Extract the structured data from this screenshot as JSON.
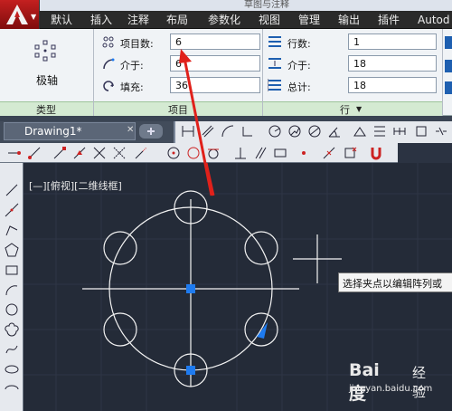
{
  "window": {
    "title": "草图与注释"
  },
  "ribbon_tabs": [
    "默认",
    "插入",
    "注释",
    "布局",
    "参数化",
    "视图",
    "管理",
    "输出",
    "插件",
    "Autod"
  ],
  "ribbon": {
    "type_group": {
      "button_label": "极轴",
      "group_label": "类型"
    },
    "items_group": {
      "group_label": "项目",
      "fields": [
        {
          "label": "项目数:",
          "value": "6",
          "icon": "polar-items-icon"
        },
        {
          "label": "介于:",
          "value": "6",
          "icon": "angle-between-icon"
        },
        {
          "label": "填充:",
          "value": "36",
          "icon": "fill-angle-icon"
        }
      ]
    },
    "rows_group": {
      "group_label": "行",
      "fields": [
        {
          "label": "行数:",
          "value": "1",
          "icon": "rows-icon"
        },
        {
          "label": "介于:",
          "value": "18",
          "icon": "row-between-icon"
        },
        {
          "label": "总计:",
          "value": "18",
          "icon": "row-total-icon"
        }
      ]
    }
  },
  "document_tab": {
    "label": "Drawing1*"
  },
  "canvas": {
    "viewport_label": "[—][俯视][二维线框]",
    "tooltip": "选择夹点以编辑阵列或",
    "grip_color": "#1e7bf0",
    "arrow_color": "#e0211b"
  },
  "watermark": {
    "brand": "Bai度",
    "suffix": "经验",
    "url": "jingyan.baidu.com"
  }
}
